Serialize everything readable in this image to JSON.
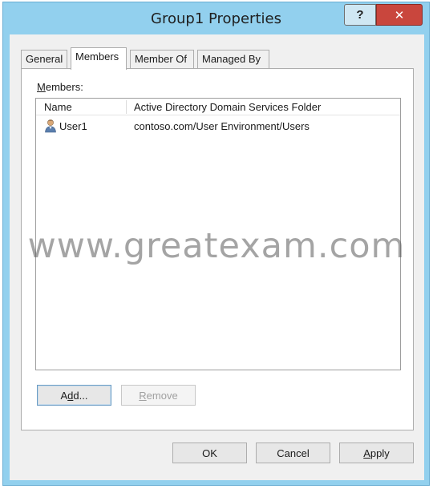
{
  "window": {
    "title": "Group1 Properties",
    "help_label": "?",
    "close_label": "✕"
  },
  "tabs": [
    {
      "label": "General",
      "active": false
    },
    {
      "label": "Members",
      "active": true
    },
    {
      "label": "Member Of",
      "active": false
    },
    {
      "label": "Managed By",
      "active": false
    }
  ],
  "members": {
    "label_accel": "M",
    "label_rest": "embers:",
    "columns": [
      "Name",
      "Active Directory Domain Services Folder"
    ],
    "rows": [
      {
        "name": "User1",
        "folder": "contoso.com/User Environment/Users",
        "icon": "user-icon"
      }
    ]
  },
  "buttons": {
    "add_accel": "d",
    "add_pre": "A",
    "add_post": "d...",
    "remove_accel": "R",
    "remove_rest": "emove",
    "ok": "OK",
    "cancel": "Cancel",
    "apply_accel": "A",
    "apply_rest": "pply"
  },
  "watermark": "www.greatexam.com",
  "colors": {
    "frame": "#92d0ee",
    "close": "#c9463d",
    "client": "#f0f0f0"
  }
}
